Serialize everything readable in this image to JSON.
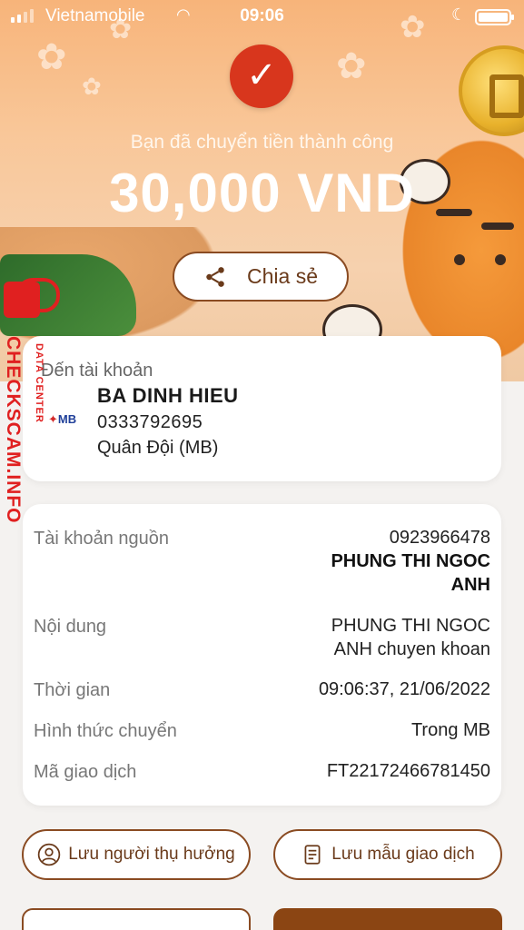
{
  "status_bar": {
    "carrier": "Vietnamobile",
    "time": "09:06"
  },
  "hero": {
    "success_text": "Bạn đã chuyển tiền thành công",
    "amount": "30,000 VND",
    "share_label": "Chia sẻ"
  },
  "recipient": {
    "to_label": "Đến tài khoản",
    "bank_logo": "MB",
    "name": "BA DINH HIEU",
    "account": "0333792695",
    "bank": "Quân Đội (MB)"
  },
  "details": {
    "source_label": "Tài khoản nguồn",
    "source_account": "0923966478",
    "source_name_line1": "PHUNG THI NGOC",
    "source_name_line2": "ANH",
    "content_label": "Nội dung",
    "content_line1": "PHUNG THI NGOC",
    "content_line2": "ANH chuyen khoan",
    "time_label": "Thời gian",
    "time_value": "09:06:37, 21/06/2022",
    "method_label": "Hình thức chuyển",
    "method_value": "Trong MB",
    "txn_label": "Mã giao dịch",
    "txn_value": "FT22172466781450"
  },
  "actions": {
    "save_recipient": "Lưu người thụ hưởng",
    "save_template": "Lưu mẫu giao dịch"
  },
  "watermark": {
    "main": "CHECKSCAM.INFO",
    "sub": "DATA CENTER"
  },
  "colors": {
    "accent": "#8a4b22",
    "success_red": "#d8361d",
    "watermark_red": "#e02020"
  }
}
